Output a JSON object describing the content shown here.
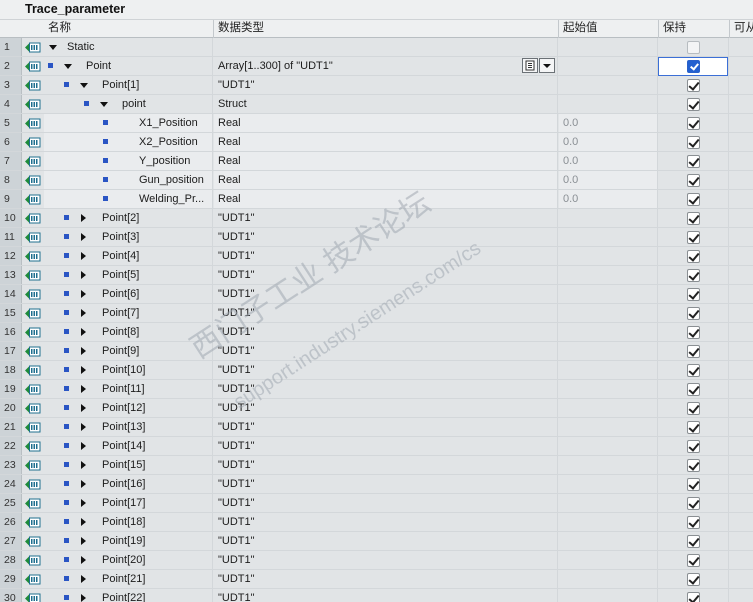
{
  "title": "Trace_parameter",
  "columns": {
    "name": "名称",
    "type": "数据类型",
    "start": "起始值",
    "retain": "保持",
    "access": "可从"
  },
  "watermark": {
    "line1": "西门子工业  技术论坛",
    "line2": "support.industry.siemens.com/cs"
  },
  "rows": [
    {
      "num": "1",
      "name": "Static",
      "type": "",
      "start": "",
      "retain": "off",
      "level": 0,
      "expand": "down",
      "bullet": false,
      "alt": false
    },
    {
      "num": "2",
      "name": "Point",
      "type": "Array[1..300] of \"UDT1\"",
      "start": "",
      "retain": "selected",
      "level": 1,
      "expand": "down",
      "bullet": true,
      "alt": false
    },
    {
      "num": "3",
      "name": "Point[1]",
      "type": "\"UDT1\"",
      "start": "",
      "retain": "on",
      "level": 2,
      "expand": "down",
      "bullet": true,
      "alt": false
    },
    {
      "num": "4",
      "name": "point",
      "type": "Struct",
      "start": "",
      "retain": "on",
      "level": 3,
      "expand": "down",
      "bullet": true,
      "alt": false
    },
    {
      "num": "5",
      "name": "X1_Position",
      "type": "Real",
      "start": "0.0",
      "retain": "on",
      "level": 4,
      "expand": "none",
      "bullet": true,
      "alt": true
    },
    {
      "num": "6",
      "name": "X2_Position",
      "type": "Real",
      "start": "0.0",
      "retain": "on",
      "level": 4,
      "expand": "none",
      "bullet": true,
      "alt": true
    },
    {
      "num": "7",
      "name": "Y_position",
      "type": "Real",
      "start": "0.0",
      "retain": "on",
      "level": 4,
      "expand": "none",
      "bullet": true,
      "alt": true
    },
    {
      "num": "8",
      "name": "Gun_position",
      "type": "Real",
      "start": "0.0",
      "retain": "on",
      "level": 4,
      "expand": "none",
      "bullet": true,
      "alt": true
    },
    {
      "num": "9",
      "name": "Welding_Pr...",
      "type": "Real",
      "start": "0.0",
      "retain": "on",
      "level": 4,
      "expand": "none",
      "bullet": true,
      "alt": true
    },
    {
      "num": "10",
      "name": "Point[2]",
      "type": "\"UDT1\"",
      "start": "",
      "retain": "on",
      "level": 2,
      "expand": "right",
      "bullet": true,
      "alt": false
    },
    {
      "num": "11",
      "name": "Point[3]",
      "type": "\"UDT1\"",
      "start": "",
      "retain": "on",
      "level": 2,
      "expand": "right",
      "bullet": true,
      "alt": false
    },
    {
      "num": "12",
      "name": "Point[4]",
      "type": "\"UDT1\"",
      "start": "",
      "retain": "on",
      "level": 2,
      "expand": "right",
      "bullet": true,
      "alt": false
    },
    {
      "num": "13",
      "name": "Point[5]",
      "type": "\"UDT1\"",
      "start": "",
      "retain": "on",
      "level": 2,
      "expand": "right",
      "bullet": true,
      "alt": false
    },
    {
      "num": "14",
      "name": "Point[6]",
      "type": "\"UDT1\"",
      "start": "",
      "retain": "on",
      "level": 2,
      "expand": "right",
      "bullet": true,
      "alt": false
    },
    {
      "num": "15",
      "name": "Point[7]",
      "type": "\"UDT1\"",
      "start": "",
      "retain": "on",
      "level": 2,
      "expand": "right",
      "bullet": true,
      "alt": false
    },
    {
      "num": "16",
      "name": "Point[8]",
      "type": "\"UDT1\"",
      "start": "",
      "retain": "on",
      "level": 2,
      "expand": "right",
      "bullet": true,
      "alt": false
    },
    {
      "num": "17",
      "name": "Point[9]",
      "type": "\"UDT1\"",
      "start": "",
      "retain": "on",
      "level": 2,
      "expand": "right",
      "bullet": true,
      "alt": false
    },
    {
      "num": "18",
      "name": "Point[10]",
      "type": "\"UDT1\"",
      "start": "",
      "retain": "on",
      "level": 2,
      "expand": "right",
      "bullet": true,
      "alt": false
    },
    {
      "num": "19",
      "name": "Point[11]",
      "type": "\"UDT1\"",
      "start": "",
      "retain": "on",
      "level": 2,
      "expand": "right",
      "bullet": true,
      "alt": false
    },
    {
      "num": "20",
      "name": "Point[12]",
      "type": "\"UDT1\"",
      "start": "",
      "retain": "on",
      "level": 2,
      "expand": "right",
      "bullet": true,
      "alt": false
    },
    {
      "num": "21",
      "name": "Point[13]",
      "type": "\"UDT1\"",
      "start": "",
      "retain": "on",
      "level": 2,
      "expand": "right",
      "bullet": true,
      "alt": false
    },
    {
      "num": "22",
      "name": "Point[14]",
      "type": "\"UDT1\"",
      "start": "",
      "retain": "on",
      "level": 2,
      "expand": "right",
      "bullet": true,
      "alt": false
    },
    {
      "num": "23",
      "name": "Point[15]",
      "type": "\"UDT1\"",
      "start": "",
      "retain": "on",
      "level": 2,
      "expand": "right",
      "bullet": true,
      "alt": false
    },
    {
      "num": "24",
      "name": "Point[16]",
      "type": "\"UDT1\"",
      "start": "",
      "retain": "on",
      "level": 2,
      "expand": "right",
      "bullet": true,
      "alt": false
    },
    {
      "num": "25",
      "name": "Point[17]",
      "type": "\"UDT1\"",
      "start": "",
      "retain": "on",
      "level": 2,
      "expand": "right",
      "bullet": true,
      "alt": false
    },
    {
      "num": "26",
      "name": "Point[18]",
      "type": "\"UDT1\"",
      "start": "",
      "retain": "on",
      "level": 2,
      "expand": "right",
      "bullet": true,
      "alt": false
    },
    {
      "num": "27",
      "name": "Point[19]",
      "type": "\"UDT1\"",
      "start": "",
      "retain": "on",
      "level": 2,
      "expand": "right",
      "bullet": true,
      "alt": false
    },
    {
      "num": "28",
      "name": "Point[20]",
      "type": "\"UDT1\"",
      "start": "",
      "retain": "on",
      "level": 2,
      "expand": "right",
      "bullet": true,
      "alt": false
    },
    {
      "num": "29",
      "name": "Point[21]",
      "type": "\"UDT1\"",
      "start": "",
      "retain": "on",
      "level": 2,
      "expand": "right",
      "bullet": true,
      "alt": false
    },
    {
      "num": "30",
      "name": "Point[22]",
      "type": "\"UDT1\"",
      "start": "",
      "retain": "on",
      "level": 2,
      "expand": "right",
      "bullet": true,
      "alt": false
    }
  ]
}
